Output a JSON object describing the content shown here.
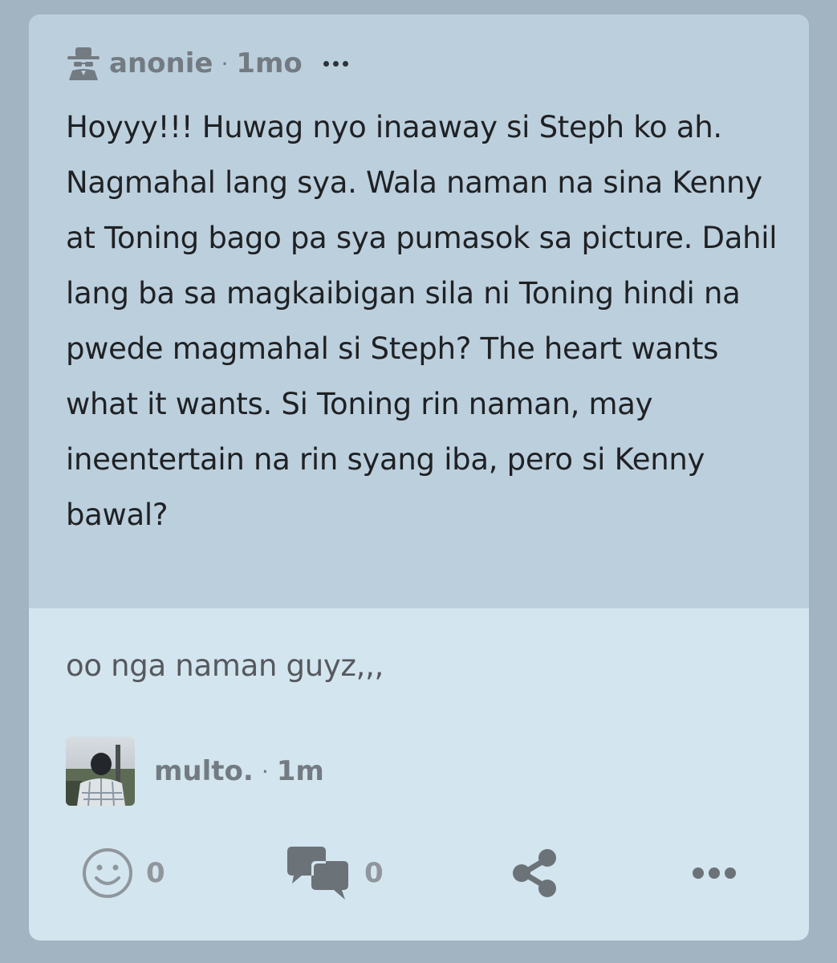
{
  "post": {
    "username": "anonie",
    "separator": "·",
    "time": "1mo",
    "body": "Hoyyy!!! Huwag nyo inaaway si Steph ko ah. Nagmahal lang sya. Wala naman na sina Kenny at Toning bago pa sya pumasok sa picture. Dahil lang ba sa magkaibigan sila ni Toning hindi na pwede magmahal si Steph? The heart wants what it wants. Si Toning rin naman, may ineentertain na rin syang iba, pero si Kenny bawal?",
    "author_icon": "spy-icon",
    "menu_icon": "more-horizontal-icon"
  },
  "comment": {
    "text": "oo nga naman guyz,,,",
    "username": "multo.",
    "separator": "·",
    "time": "1m"
  },
  "actions": {
    "reactions": {
      "icon": "smiley-icon",
      "count": "0"
    },
    "comments": {
      "icon": "comments-icon",
      "count": "0"
    },
    "share": {
      "icon": "share-icon"
    },
    "more": {
      "icon": "more-horizontal-icon"
    }
  },
  "colors": {
    "page_bg": "#a2b3c2",
    "post_bg": "#bccfdd",
    "comment_bg": "#d3e5ef",
    "meta_text": "#737b82",
    "action_gray": "#8f969c"
  }
}
